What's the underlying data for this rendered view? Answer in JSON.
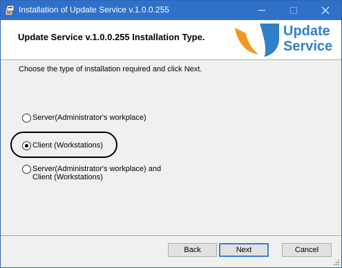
{
  "window": {
    "title": "Installation of Update Service v.1.0.0.255",
    "accent_color": "#2f70c9"
  },
  "header": {
    "title": "Update Service v.1.0.0.255 Installation Type.",
    "logo_line1": "Update",
    "logo_line2": "Service",
    "logo_colors": {
      "orange": "#f5a623",
      "blue": "#2f80c8"
    }
  },
  "instruction": "Choose the type of installation required and click Next.",
  "options": [
    {
      "label": "Server(Administrator's workplace)",
      "checked": false
    },
    {
      "label": "Client (Workstations)",
      "checked": true
    },
    {
      "label_line1": "Server(Administrator's workplace) and",
      "label_line2": "Client (Workstations)",
      "checked": false
    }
  ],
  "buttons": {
    "back": "Back",
    "next": "Next",
    "cancel": "Cancel"
  }
}
